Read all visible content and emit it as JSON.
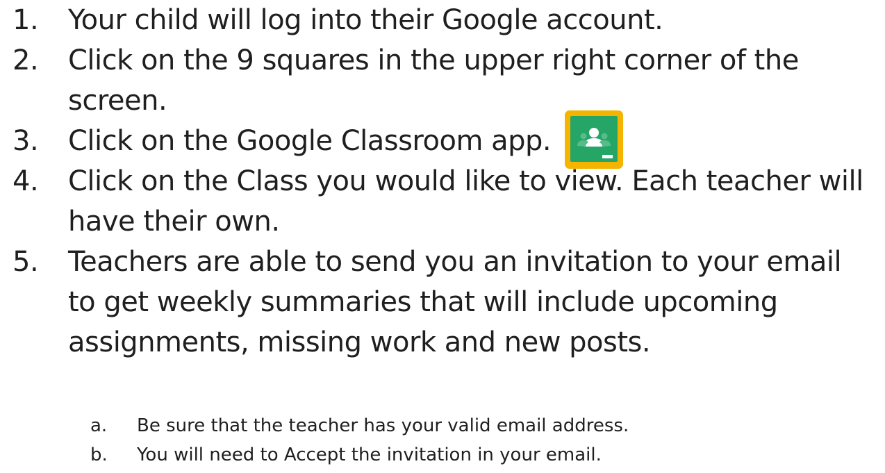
{
  "steps": [
    {
      "number": "1.",
      "text": "Your child will log into their Google account."
    },
    {
      "number": "2.",
      "text": "Click on the 9 squares in the upper right corner of the screen."
    },
    {
      "number": "3.",
      "text": "Click on the Google Classroom app."
    },
    {
      "number": "4.",
      "text": "Click on the Class you would like to view. Each teacher will have their own."
    },
    {
      "number": "5.",
      "text": "Teachers are able to send you an invitation to your email to get weekly summaries that will include upcoming assignments, missing work and new posts."
    }
  ],
  "substeps": [
    {
      "letter": "a.",
      "text": "Be sure that the teacher has your valid email address."
    },
    {
      "letter": "b.",
      "text": "You will need to Accept the invitation in your email."
    }
  ],
  "icon": {
    "name": "google-classroom-icon",
    "frame_color": "#F4B400",
    "board_color": "#25A667",
    "figure_color": "#FFFFFF"
  }
}
